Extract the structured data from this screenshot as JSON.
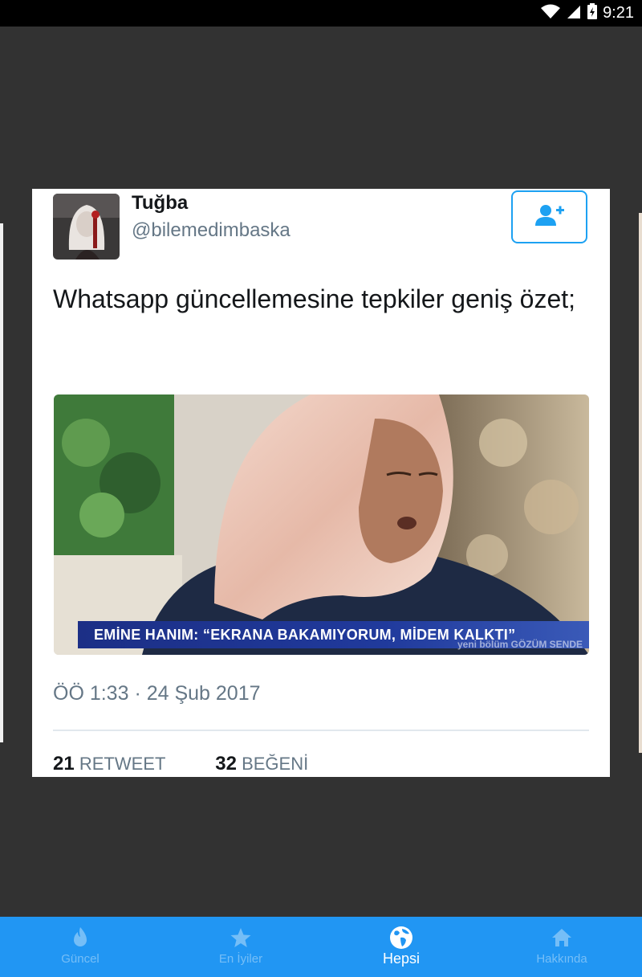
{
  "status_bar": {
    "time": "9:21",
    "icons": [
      "wifi-icon",
      "signal-icon",
      "battery-charging-icon"
    ]
  },
  "tweet": {
    "author_name": "Tuğba",
    "author_handle": "@bilemedimbaska",
    "text": "Whatsapp güncellemesine tepkiler geniş özet;",
    "media_caption": "EMİNE HANIM: “EKRANA BAKAMIYORUM, MİDEM KALKTI”",
    "media_watermark": "yeni bölüm GÖZÜM SENDE",
    "timestamp": "ÖÖ 1:33 · 24 Şub 2017",
    "retweet_count": "21",
    "retweet_label": "RETWEET",
    "like_count": "32",
    "like_label": "BEĞENİ",
    "follow_icon": "add-user-icon"
  },
  "bottom_nav": {
    "items": [
      {
        "label": "Güncel",
        "icon": "flame-icon",
        "active": false
      },
      {
        "label": "En İyiler",
        "icon": "star-icon",
        "active": false
      },
      {
        "label": "Hepsi",
        "icon": "globe-icon",
        "active": true
      },
      {
        "label": "Hakkında",
        "icon": "home-icon",
        "active": false
      }
    ]
  },
  "colors": {
    "background": "#323232",
    "nav_bar": "#2196f3",
    "twitter_blue": "#1da1f2",
    "secondary_text": "#657786"
  }
}
